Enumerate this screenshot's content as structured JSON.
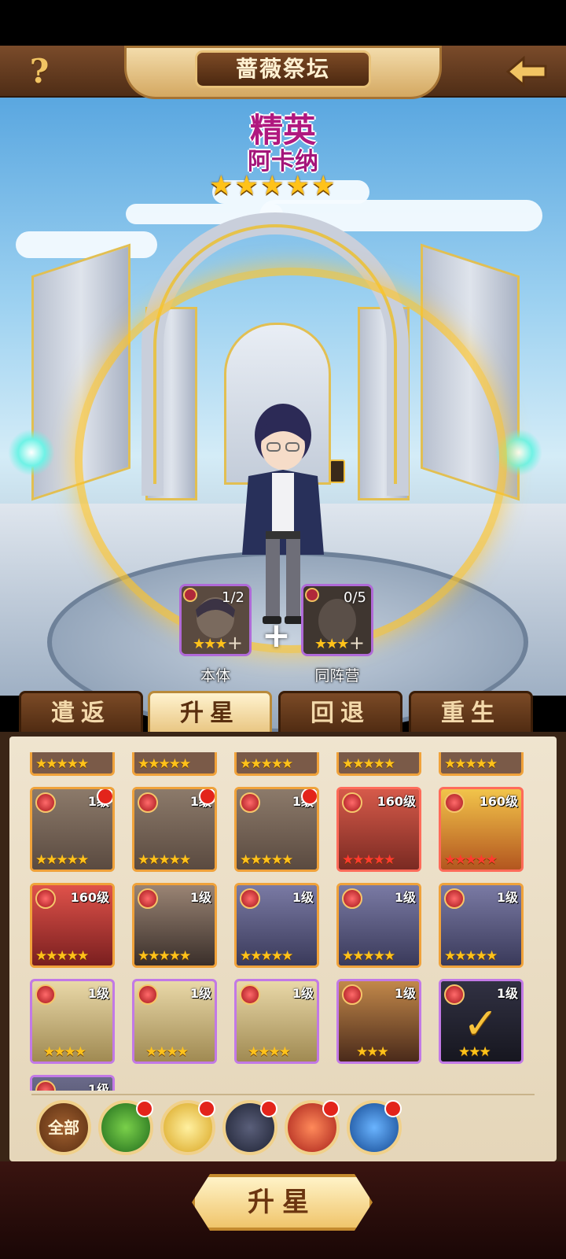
{
  "header": {
    "title": "蔷薇祭坛",
    "help_icon": "?"
  },
  "hero": {
    "rank": "精英",
    "name": "阿卡纳",
    "stars": 5
  },
  "materials": [
    {
      "count": "1/2",
      "label": "本体",
      "stars": 3
    },
    {
      "count": "0/5",
      "label": "同阵营",
      "stars": 3
    }
  ],
  "tabs": [
    {
      "label": "遣返",
      "active": false
    },
    {
      "label": "升星",
      "active": true
    },
    {
      "label": "回退",
      "active": false
    },
    {
      "label": "重生",
      "active": false
    }
  ],
  "cards": [
    {
      "level": "1级",
      "stars": 5,
      "frame": "orange",
      "alert": true
    },
    {
      "level": "1级",
      "stars": 5,
      "frame": "orange",
      "alert": true
    },
    {
      "level": "1级",
      "stars": 5,
      "frame": "orange",
      "alert": true
    },
    {
      "level": "160级",
      "stars": 5,
      "frame": "red",
      "star_color": "red"
    },
    {
      "level": "160级",
      "stars": 5,
      "frame": "red",
      "star_color": "red"
    },
    {
      "level": "160级",
      "stars": 5,
      "frame": "orange"
    },
    {
      "level": "1级",
      "stars": 5,
      "frame": "orange"
    },
    {
      "level": "1级",
      "stars": 5,
      "frame": "orange"
    },
    {
      "level": "1级",
      "stars": 5,
      "frame": "orange"
    },
    {
      "level": "1级",
      "stars": 5,
      "frame": "orange"
    },
    {
      "level": "1级",
      "stars": 4,
      "frame": "purple"
    },
    {
      "level": "1级",
      "stars": 4,
      "frame": "purple"
    },
    {
      "level": "1级",
      "stars": 4,
      "frame": "purple"
    },
    {
      "level": "1级",
      "stars": 3,
      "frame": "purple"
    },
    {
      "level": "1级",
      "stars": 3,
      "frame": "purple",
      "selected": true
    },
    {
      "level": "1级",
      "stars": 0,
      "frame": "purple"
    }
  ],
  "filters": [
    {
      "label": "全部",
      "icon": "all-filter",
      "color": "#8a4a22"
    },
    {
      "label": "",
      "icon": "nature-faction-icon",
      "color": "#2f8a2a"
    },
    {
      "label": "",
      "icon": "rose-faction-icon",
      "color": "#e1b12a"
    },
    {
      "label": "",
      "icon": "dark-star-faction-icon",
      "color": "#2a2f4a"
    },
    {
      "label": "",
      "icon": "fire-phoenix-faction-icon",
      "color": "#c2351f"
    },
    {
      "label": "",
      "icon": "water-dragon-faction-icon",
      "color": "#1d5fb8"
    }
  ],
  "action": {
    "label": "升星"
  }
}
